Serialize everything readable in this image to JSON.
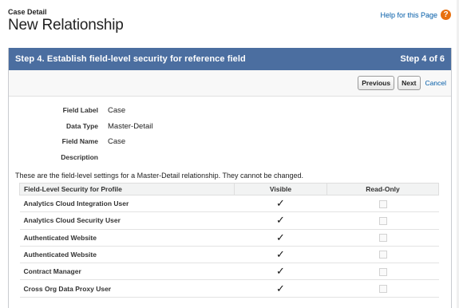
{
  "header": {
    "breadcrumb": "Case Detail",
    "title": "New Relationship",
    "help_link": "Help for this Page",
    "help_icon": "question-icon",
    "help_icon_glyph": "?"
  },
  "step": {
    "title": "Step 4. Establish field-level security for reference field",
    "indicator": "Step 4 of 6"
  },
  "buttons": {
    "previous": "Previous",
    "next": "Next",
    "cancel": "Cancel"
  },
  "details": [
    {
      "label": "Field Label",
      "value": "Case"
    },
    {
      "label": "Data Type",
      "value": "Master-Detail"
    },
    {
      "label": "Field Name",
      "value": "Case"
    },
    {
      "label": "Description",
      "value": ""
    }
  ],
  "note": "These are the field-level settings for a Master-Detail relationship. They cannot be changed.",
  "table": {
    "headers": {
      "profile": "Field-Level Security for Profile",
      "visible": "Visible",
      "read_only": "Read-Only"
    },
    "rows": [
      {
        "profile": "Analytics Cloud Integration User",
        "visible": true,
        "read_only": false
      },
      {
        "profile": "Analytics Cloud Security User",
        "visible": true,
        "read_only": false
      },
      {
        "profile": "Authenticated Website",
        "visible": true,
        "read_only": false
      },
      {
        "profile": "Authenticated Website",
        "visible": true,
        "read_only": false
      },
      {
        "profile": "Contract Manager",
        "visible": true,
        "read_only": false
      },
      {
        "profile": "Cross Org Data Proxy User",
        "visible": true,
        "read_only": false
      }
    ]
  },
  "colors": {
    "step_bar": "#4b6ea0",
    "link": "#015ba7",
    "help_icon": "#e8700f"
  },
  "icons": {
    "checkmark": "✓"
  }
}
